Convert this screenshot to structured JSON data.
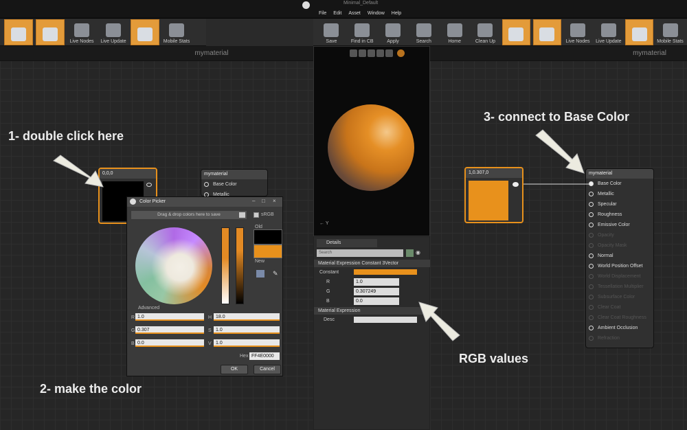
{
  "window": {
    "title": "Minimal_Default",
    "menu": [
      "File",
      "Edit",
      "Asset",
      "Window",
      "Help"
    ]
  },
  "toolbar_left": [
    {
      "label": "",
      "icon": "stats-icon",
      "on": true
    },
    {
      "label": "",
      "icon": "preview-icon",
      "on": true
    },
    {
      "label": "Live Nodes",
      "icon": "live-nodes-icon",
      "on": false
    },
    {
      "label": "Live Update",
      "icon": "live-update-icon",
      "on": false
    },
    {
      "label": "",
      "icon": "stats-bars-icon",
      "on": true
    },
    {
      "label": "Mobile Stats",
      "icon": "mobile-stats-icon",
      "on": false
    }
  ],
  "toolbar_right": [
    {
      "label": "Save",
      "icon": "save-icon",
      "on": false
    },
    {
      "label": "Find in CB",
      "icon": "find-icon",
      "on": false
    },
    {
      "label": "Apply",
      "icon": "apply-icon",
      "on": false
    },
    {
      "label": "Search",
      "icon": "search-icon",
      "on": false
    },
    {
      "label": "Home",
      "icon": "home-icon",
      "on": false
    },
    {
      "label": "Clean Up",
      "icon": "cleanup-icon",
      "on": false
    },
    {
      "label": "",
      "icon": "stats-icon",
      "on": true
    },
    {
      "label": "",
      "icon": "preview-icon",
      "on": true
    },
    {
      "label": "Live Nodes",
      "icon": "live-nodes-icon",
      "on": false
    },
    {
      "label": "Live Update",
      "icon": "live-update-icon",
      "on": false
    },
    {
      "label": "",
      "icon": "stats-bars-icon",
      "on": true
    },
    {
      "label": "Mobile Stats",
      "icon": "mobile-stats-icon",
      "on": false
    }
  ],
  "left_graph": {
    "header": "mymaterial",
    "constant_node": {
      "title": "0,0,0"
    },
    "material_node": {
      "title": "mymaterial",
      "pins": [
        "Base Color",
        "Metallic"
      ]
    }
  },
  "right_graph": {
    "header": "mymaterial",
    "constant_node": {
      "title": "1,0.307,0"
    },
    "material_node": {
      "title": "mymaterial",
      "pins": [
        {
          "label": "Base Color",
          "active": true,
          "filled": true
        },
        {
          "label": "Metallic",
          "active": true
        },
        {
          "label": "Specular",
          "active": true
        },
        {
          "label": "Roughness",
          "active": true
        },
        {
          "label": "Emissive Color",
          "active": true
        },
        {
          "label": "Opacity",
          "active": false
        },
        {
          "label": "Opacity Mask",
          "active": false
        },
        {
          "label": "Normal",
          "active": true
        },
        {
          "label": "World Position Offset",
          "active": true
        },
        {
          "label": "World Displacement",
          "active": false
        },
        {
          "label": "Tessellation Multiplier",
          "active": false
        },
        {
          "label": "Subsurface Color",
          "active": false
        },
        {
          "label": "Clear Coat",
          "active": false
        },
        {
          "label": "Clear Coat Roughness",
          "active": false
        },
        {
          "label": "Ambient Occlusion",
          "active": true
        },
        {
          "label": "Refraction",
          "active": false
        }
      ]
    }
  },
  "color_picker": {
    "title": "Color Picker",
    "drop_hint": "Drag & drop colors here to save",
    "srgb": "sRGB",
    "old_label": "Old",
    "new_label": "New",
    "advanced": "Advanced",
    "fields": {
      "R": {
        "label": "R",
        "value": "1.0"
      },
      "G": {
        "label": "G",
        "value": "0.307"
      },
      "B": {
        "label": "B",
        "value": "0.0"
      },
      "H": {
        "label": "H",
        "value": "18.0"
      },
      "S": {
        "label": "S",
        "value": "1.0"
      },
      "V": {
        "label": "V",
        "value": "1.0"
      }
    },
    "hex_label": "Hex",
    "hex_value": "FF4E0000",
    "ok": "OK",
    "cancel": "Cancel"
  },
  "details": {
    "tab": "Details",
    "search_placeholder": "Search",
    "section1": "Material Expression Constant 3Vector",
    "constant_label": "Constant",
    "rows": [
      {
        "label": "R",
        "value": "1.0"
      },
      {
        "label": "G",
        "value": "0.307249"
      },
      {
        "label": "B",
        "value": "0.0"
      }
    ],
    "section2": "Material Expression",
    "desc_label": "Desc"
  },
  "viewport": {
    "axis_label": "Y"
  },
  "annotations": {
    "step1": "1- double click here",
    "step2": "2- make the color",
    "step3": "3- connect to Base Color",
    "rgb": "RGB values"
  },
  "colors": {
    "accent": "#e8911c",
    "selected_color": "#e8911c",
    "old_color": "#000000"
  }
}
